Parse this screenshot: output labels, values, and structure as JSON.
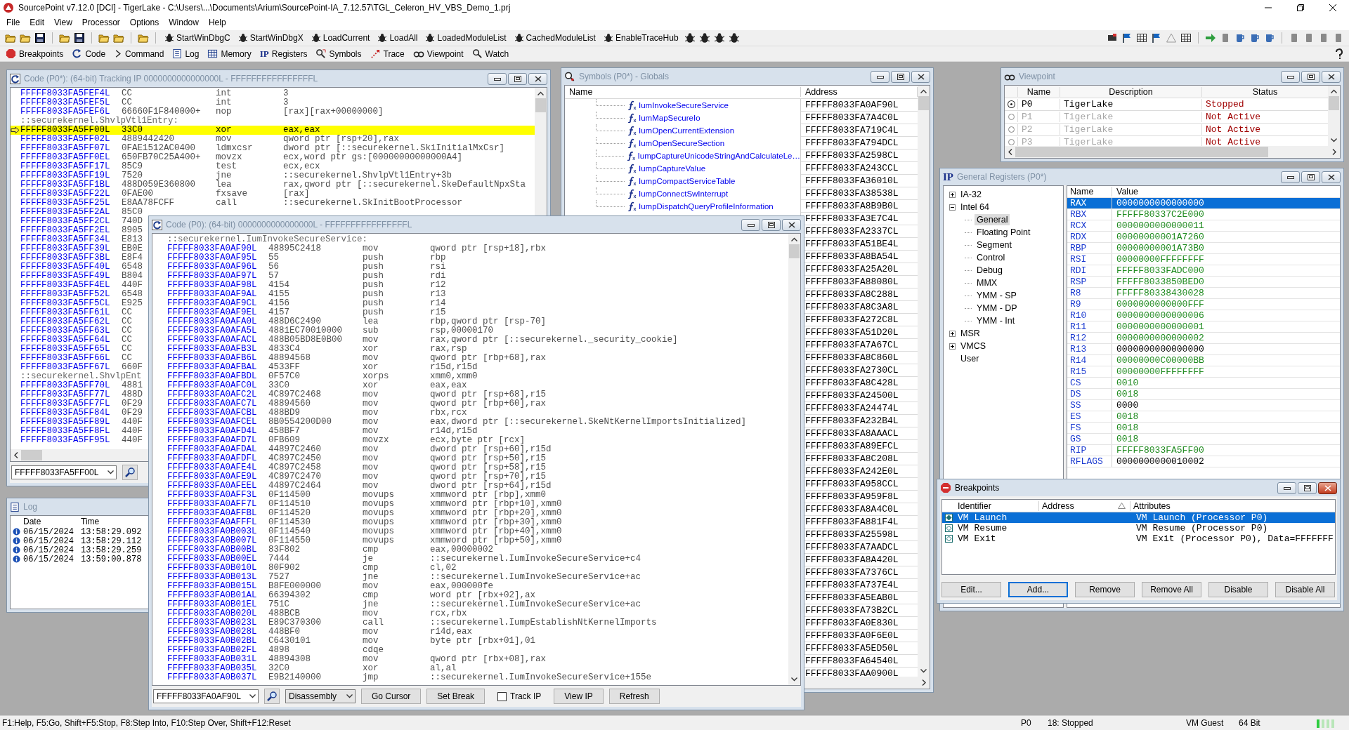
{
  "app": {
    "title": "SourcePoint v7.12.0 [DCI] - TigerLake - C:\\Users\\...\\Documents\\Arium\\SourcePoint-IA_7.12.57\\TGL_Celeron_HV_VBS_Demo_1.prj",
    "menu": [
      "File",
      "Edit",
      "View",
      "Processor",
      "Options",
      "Window",
      "Help"
    ]
  },
  "toolbar": {
    "commands": [
      "StartWinDbgC",
      "StartWinDbgX",
      "LoadCurrent",
      "LoadAll",
      "LoadedModuleList",
      "CachedModuleList",
      "EnableTraceHub"
    ]
  },
  "view_bar": [
    {
      "kind": "stop",
      "label": "Breakpoints"
    },
    {
      "kind": "code",
      "label": "Code"
    },
    {
      "kind": "command",
      "label": "Command"
    },
    {
      "kind": "log",
      "label": "Log"
    },
    {
      "kind": "memory",
      "label": "Memory"
    },
    {
      "kind": "registers",
      "glyph": "IP",
      "label": "Registers"
    },
    {
      "kind": "symbols",
      "label": "Symbols"
    },
    {
      "kind": "trace",
      "label": "Trace"
    },
    {
      "kind": "viewpoint",
      "label": "Viewpoint"
    },
    {
      "kind": "watch",
      "label": "Watch"
    }
  ],
  "code_tracking": {
    "title": "Code (P0*): (64-bit) Tracking IP 0000000000000000L - FFFFFFFFFFFFFFFFL",
    "active": false,
    "address_field": "FFFFF8033FA5FF00L",
    "rows": [
      {
        "kind": "instr",
        "current": false,
        "address": "FFFFF8033FA5FEF4L",
        "opcode": "CC",
        "mnemonic": "int",
        "operand": "3"
      },
      {
        "kind": "instr",
        "current": false,
        "address": "FFFFF8033FA5FEF5L",
        "opcode": "CC",
        "mnemonic": "int",
        "operand": "3"
      },
      {
        "kind": "instr",
        "current": false,
        "address": "FFFFF8033FA5FEF6L",
        "opcode": "66660F1F840000+",
        "mnemonic": "nop",
        "operand": "[rax][rax+00000000]"
      },
      {
        "kind": "label",
        "text": "::securekernel.ShvlpVtl1Entry:"
      },
      {
        "kind": "instr",
        "current": true,
        "address": "FFFFF8033FA5FF00L",
        "opcode": "33C0",
        "mnemonic": "xor",
        "operand": "eax,eax"
      },
      {
        "kind": "instr",
        "current": false,
        "address": "FFFFF8033FA5FF02L",
        "opcode": "4889442420",
        "mnemonic": "mov",
        "operand": "qword ptr [rsp+20],rax"
      },
      {
        "kind": "instr",
        "current": false,
        "address": "FFFFF8033FA5FF07L",
        "opcode": "0FAE1512AC0400",
        "mnemonic": "ldmxcsr",
        "operand": "dword ptr [::securekernel.SkiInitialMxCsr]"
      },
      {
        "kind": "instr",
        "current": false,
        "address": "FFFFF8033FA5FF0EL",
        "opcode": "650FB70C25A400+",
        "mnemonic": "movzx",
        "operand": "ecx,word ptr gs:[00000000000000A4]"
      },
      {
        "kind": "instr",
        "current": false,
        "address": "FFFFF8033FA5FF17L",
        "opcode": "85C9",
        "mnemonic": "test",
        "operand": "ecx,ecx"
      },
      {
        "kind": "instr",
        "current": false,
        "address": "FFFFF8033FA5FF19L",
        "opcode": "7520",
        "mnemonic": "jne",
        "operand": "::securekernel.ShvlpVtl1Entry+3b"
      },
      {
        "kind": "instr",
        "current": false,
        "address": "FFFFF8033FA5FF1BL",
        "opcode": "488D059E360800",
        "mnemonic": "lea",
        "operand": "rax,qword ptr [::securekernel.SkeDefaultNpxSta"
      },
      {
        "kind": "instr",
        "current": false,
        "address": "FFFFF8033FA5FF22L",
        "opcode": "0FAE00",
        "mnemonic": "fxsave",
        "operand": "[rax]"
      },
      {
        "kind": "instr",
        "current": false,
        "address": "FFFFF8033FA5FF25L",
        "opcode": "E8AA78FCFF",
        "mnemonic": "call",
        "operand": "::securekernel.SkInitBootProcessor"
      },
      {
        "kind": "instr",
        "current": false,
        "address": "FFFFF8033FA5FF2AL",
        "opcode": "85C0"
      },
      {
        "kind": "instr",
        "current": false,
        "address": "FFFFF8033FA5FF2CL",
        "opcode": "740D"
      },
      {
        "kind": "instr",
        "current": false,
        "address": "FFFFF8033FA5FF2EL",
        "opcode": "8905"
      },
      {
        "kind": "instr",
        "current": false,
        "address": "FFFFF8033FA5FF34L",
        "opcode": "E813"
      },
      {
        "kind": "instr",
        "current": false,
        "address": "FFFFF8033FA5FF39L",
        "opcode": "EB0E"
      },
      {
        "kind": "instr",
        "current": false,
        "address": "FFFFF8033FA5FF3BL",
        "opcode": "E8F4"
      },
      {
        "kind": "instr",
        "current": false,
        "address": "FFFFF8033FA5FF40L",
        "opcode": "6548"
      },
      {
        "kind": "instr",
        "current": false,
        "address": "FFFFF8033FA5FF49L",
        "opcode": "B804"
      },
      {
        "kind": "instr",
        "current": false,
        "address": "FFFFF8033FA5FF4EL",
        "opcode": "440F"
      },
      {
        "kind": "instr",
        "current": false,
        "address": "FFFFF8033FA5FF52L",
        "opcode": "6548"
      },
      {
        "kind": "instr",
        "current": false,
        "address": "FFFFF8033FA5FF5CL",
        "opcode": "E925"
      },
      {
        "kind": "instr",
        "current": false,
        "address": "FFFFF8033FA5FF61L",
        "opcode": "CC"
      },
      {
        "kind": "instr",
        "current": false,
        "address": "FFFFF8033FA5FF62L",
        "opcode": "CC"
      },
      {
        "kind": "instr",
        "current": false,
        "address": "FFFFF8033FA5FF63L",
        "opcode": "CC"
      },
      {
        "kind": "instr",
        "current": false,
        "address": "FFFFF8033FA5FF64L",
        "opcode": "CC"
      },
      {
        "kind": "instr",
        "current": false,
        "address": "FFFFF8033FA5FF65L",
        "opcode": "CC"
      },
      {
        "kind": "instr",
        "current": false,
        "address": "FFFFF8033FA5FF66L",
        "opcode": "CC"
      },
      {
        "kind": "instr",
        "current": false,
        "address": "FFFFF8033FA5FF67L",
        "opcode": "660F"
      },
      {
        "kind": "label",
        "text": "::securekernel.ShvlpEnt"
      },
      {
        "kind": "instr",
        "current": false,
        "address": "FFFFF8033FA5FF70L",
        "opcode": "4881"
      },
      {
        "kind": "instr",
        "current": false,
        "address": "FFFFF8033FA5FF77L",
        "opcode": "488D"
      },
      {
        "kind": "instr",
        "current": false,
        "address": "FFFFF8033FA5FF7FL",
        "opcode": "0F29"
      },
      {
        "kind": "instr",
        "current": false,
        "address": "FFFFF8033FA5FF84L",
        "opcode": "0F29"
      },
      {
        "kind": "instr",
        "current": false,
        "address": "FFFFF8033FA5FF89L",
        "opcode": "440F"
      },
      {
        "kind": "instr",
        "current": false,
        "address": "FFFFF8033FA5FF8FL",
        "opcode": "440F"
      },
      {
        "kind": "instr",
        "current": false,
        "address": "FFFFF8033FA5FF95L",
        "opcode": "440F"
      }
    ]
  },
  "log": {
    "title": "Log",
    "active": false,
    "columns": [
      "Date",
      "Time"
    ],
    "rows": [
      {
        "date": "06/15/2024",
        "time": "13:58:29.092"
      },
      {
        "date": "06/15/2024",
        "time": "13:58:29.112"
      },
      {
        "date": "06/15/2024",
        "time": "13:58:29.259"
      },
      {
        "date": "06/15/2024",
        "time": "13:59:00.878"
      }
    ]
  },
  "symbols": {
    "title": "Symbols (P0*) - Globals",
    "active": false,
    "columns": [
      "Name",
      "Address"
    ],
    "rows": [
      {
        "name": "IumInvokeSecureService",
        "address": "FFFFF8033FA0AF90L"
      },
      {
        "name": "IumMapSecureIo",
        "address": "FFFFF8033FA7A4C0L"
      },
      {
        "name": "IumOpenCurrentExtension",
        "address": "FFFFF8033FA719C4L"
      },
      {
        "name": "IumOpenSecureSection",
        "address": "FFFFF8033FA794DCL"
      },
      {
        "name": "IumpCaptureUnicodeStringAndCalculateLe…",
        "address": "FFFFF8033FA2598CL"
      },
      {
        "name": "IumpCaptureValue",
        "address": "FFFFF8033FA243CCL"
      },
      {
        "name": "IumpCompactServiceTable",
        "address": "FFFFF8033FA36010L"
      },
      {
        "name": "IumpConnectSwInterrupt",
        "address": "FFFFF8033FA38538L"
      },
      {
        "name": "IumpDispatchQueryProfileInformation",
        "address": "FFFFF8033FA8B9B0L"
      },
      {
        "address": "FFFFF8033FA3E7C4L"
      },
      {
        "address": "FFFFF8033FA2337CL"
      },
      {
        "address": "FFFFF8033FA51BE4L"
      },
      {
        "address": "FFFFF8033FA8BA54L"
      },
      {
        "address": "FFFFF8033FA25A20L"
      },
      {
        "address": "FFFFF8033FA88080L"
      },
      {
        "address": "FFFFF8033FA8C288L"
      },
      {
        "address": "FFFFF8033FA8C3A8L"
      },
      {
        "address": "FFFFF8033FA272C8L"
      },
      {
        "address": "FFFFF8033FA51D20L"
      },
      {
        "address": "FFFFF8033FA7A67CL"
      },
      {
        "address": "FFFFF8033FA8C860L"
      },
      {
        "address": "FFFFF8033FA2730CL"
      },
      {
        "address": "FFFFF8033FA8C428L"
      },
      {
        "address": "FFFFF8033FA24500L"
      },
      {
        "address": "FFFFF8033FA24474L"
      },
      {
        "address": "FFFFF8033FA232B4L"
      },
      {
        "address": "FFFFF8033FA8AAACL"
      },
      {
        "address": "FFFFF8033FA89EFCL"
      },
      {
        "address": "FFFFF8033FA8C208L"
      },
      {
        "address": "FFFFF8033FA242E0L"
      },
      {
        "address": "FFFFF8033FA958CCL"
      },
      {
        "address": "FFFFF8033FA959F8L"
      },
      {
        "address": "FFFFF8033FA8A4C0L"
      },
      {
        "address": "FFFFF8033FA881F4L"
      },
      {
        "address": "FFFFF8033FA25598L"
      },
      {
        "address": "FFFFF8033FA7AADCL"
      },
      {
        "address": "FFFFF8033FA8A420L"
      },
      {
        "address": "FFFFF8033FA7376CL"
      },
      {
        "address": "FFFFF8033FA737E4L"
      },
      {
        "address": "FFFFF8033FA5EAB0L"
      },
      {
        "address": "FFFFF8033FA73B2CL"
      },
      {
        "address": "FFFFF8033FA0E830L"
      },
      {
        "address": "FFFFF8033FA0F6E0L"
      },
      {
        "address": "FFFFF8033FA5ED50L"
      },
      {
        "address": "FFFFF8033FA64540L"
      },
      {
        "address": "FFFFF8033FAA0900L"
      }
    ]
  },
  "viewpoint": {
    "title": "Viewpoint",
    "active": false,
    "columns": [
      "Name",
      "Description",
      "Status"
    ],
    "rows": [
      {
        "selected": true,
        "active": true,
        "name": "P0",
        "description": "TigerLake",
        "status": "Stopped"
      },
      {
        "selected": false,
        "active": false,
        "name": "P1",
        "description": "TigerLake",
        "status": "Not Active"
      },
      {
        "selected": false,
        "active": false,
        "name": "P2",
        "description": "TigerLake",
        "status": "Not Active"
      },
      {
        "selected": false,
        "active": false,
        "name": "P3",
        "description": "TigerLake",
        "status": "Not Active"
      }
    ]
  },
  "registers": {
    "glyph": "IP",
    "title": "General Registers (P0*)",
    "active": false,
    "tree": [
      {
        "label": "IA-32",
        "expanded": false,
        "selected": false
      },
      {
        "label": "Intel 64",
        "expanded": true,
        "selected": false,
        "children": [
          {
            "label": "General",
            "selected": true
          },
          {
            "label": "Floating Point",
            "selected": false
          },
          {
            "label": "Segment",
            "selected": false
          },
          {
            "label": "Control",
            "selected": false
          },
          {
            "label": "Debug",
            "selected": false
          },
          {
            "label": "MMX",
            "selected": false
          },
          {
            "label": "YMM - SP",
            "selected": false
          },
          {
            "label": "YMM - DP",
            "selected": false
          },
          {
            "label": "YMM - Int",
            "selected": false
          }
        ]
      },
      {
        "label": "MSR",
        "expanded": false,
        "selected": false
      },
      {
        "label": "VMCS",
        "expanded": false,
        "selected": false
      },
      {
        "label": "User",
        "selected": false
      }
    ],
    "columns": [
      "Name",
      "Value"
    ],
    "rows": [
      {
        "name": "RAX",
        "value": "0000000000000000",
        "selected": true,
        "changed": false
      },
      {
        "name": "RBX",
        "value": "FFFFF80337C2E000",
        "selected": false,
        "changed": true
      },
      {
        "name": "RCX",
        "value": "0000000000000011",
        "selected": false,
        "changed": true
      },
      {
        "name": "RDX",
        "value": "00000000001A7260",
        "selected": false,
        "changed": true
      },
      {
        "name": "RBP",
        "value": "00000000001A73B0",
        "selected": false,
        "changed": true
      },
      {
        "name": "RSI",
        "value": "00000000FFFFFFFF",
        "selected": false,
        "changed": true
      },
      {
        "name": "RDI",
        "value": "FFFFF8033FADC000",
        "selected": false,
        "changed": true
      },
      {
        "name": "RSP",
        "value": "FFFFF8033850BED0",
        "selected": false,
        "changed": true
      },
      {
        "name": "R8",
        "value": "FFFFF80338430028",
        "selected": false,
        "changed": true
      },
      {
        "name": "R9",
        "value": "0000000000000FFF",
        "selected": false,
        "changed": true
      },
      {
        "name": "R10",
        "value": "0000000000000006",
        "selected": false,
        "changed": true
      },
      {
        "name": "R11",
        "value": "0000000000000001",
        "selected": false,
        "changed": true
      },
      {
        "name": "R12",
        "value": "0000000000000002",
        "selected": false,
        "changed": true
      },
      {
        "name": "R13",
        "value": "0000000000000000",
        "selected": false,
        "changed": false
      },
      {
        "name": "R14",
        "value": "00000000C00000BB",
        "selected": false,
        "changed": true
      },
      {
        "name": "R15",
        "value": "00000000FFFFFFFF",
        "selected": false,
        "changed": true
      },
      {
        "name": "CS",
        "value": "0010",
        "selected": false,
        "changed": true
      },
      {
        "name": "DS",
        "value": "0018",
        "selected": false,
        "changed": true
      },
      {
        "name": "SS",
        "value": "0000",
        "selected": false,
        "changed": false
      },
      {
        "name": "ES",
        "value": "0018",
        "selected": false,
        "changed": true
      },
      {
        "name": "FS",
        "value": "0018",
        "selected": false,
        "changed": true
      },
      {
        "name": "GS",
        "value": "0018",
        "selected": false,
        "changed": true
      },
      {
        "name": "RIP",
        "value": "FFFFF8033FA5FF00",
        "selected": false,
        "changed": true
      },
      {
        "name": "RFLAGS",
        "value": "0000000000010002",
        "selected": false,
        "changed": false
      }
    ]
  },
  "code": {
    "title": "Code (P0): (64-bit) 0000000000000000L - FFFFFFFFFFFFFFFFL",
    "active": false,
    "address_field": "FFFFF8033FA0AF90L",
    "view_select": "Disassembly",
    "buttons": [
      "Go Cursor",
      "Set Break"
    ],
    "track_ip": {
      "label": "Track IP",
      "checked": false
    },
    "buttons_after": [
      "View IP",
      "Refresh"
    ],
    "rows": [
      {
        "kind": "label",
        "text": "::securekernel.IumInvokeSecureService:"
      },
      {
        "kind": "instr",
        "address": "FFFFF8033FA0AF90L",
        "opcode": "48895C2418",
        "mnemonic": "mov",
        "operand": "qword ptr [rsp+18],rbx"
      },
      {
        "kind": "instr",
        "address": "FFFFF8033FA0AF95L",
        "opcode": "55",
        "mnemonic": "push",
        "operand": "rbp"
      },
      {
        "kind": "instr",
        "address": "FFFFF8033FA0AF96L",
        "opcode": "56",
        "mnemonic": "push",
        "operand": "rsi"
      },
      {
        "kind": "instr",
        "address": "FFFFF8033FA0AF97L",
        "opcode": "57",
        "mnemonic": "push",
        "operand": "rdi"
      },
      {
        "kind": "instr",
        "address": "FFFFF8033FA0AF98L",
        "opcode": "4154",
        "mnemonic": "push",
        "operand": "r12"
      },
      {
        "kind": "instr",
        "address": "FFFFF8033FA0AF9AL",
        "opcode": "4155",
        "mnemonic": "push",
        "operand": "r13"
      },
      {
        "kind": "instr",
        "address": "FFFFF8033FA0AF9CL",
        "opcode": "4156",
        "mnemonic": "push",
        "operand": "r14"
      },
      {
        "kind": "instr",
        "address": "FFFFF8033FA0AF9EL",
        "opcode": "4157",
        "mnemonic": "push",
        "operand": "r15"
      },
      {
        "kind": "instr",
        "address": "FFFFF8033FA0AFA0L",
        "opcode": "488D6C2490",
        "mnemonic": "lea",
        "operand": "rbp,qword ptr [rsp-70]"
      },
      {
        "kind": "instr",
        "address": "FFFFF8033FA0AFA5L",
        "opcode": "4881EC70010000",
        "mnemonic": "sub",
        "operand": "rsp,00000170"
      },
      {
        "kind": "instr",
        "address": "FFFFF8033FA0AFACL",
        "opcode": "488B05BD8E0B00",
        "mnemonic": "mov",
        "operand": "rax,qword ptr [::securekernel._security_cookie]"
      },
      {
        "kind": "instr",
        "address": "FFFFF8033FA0AFB3L",
        "opcode": "4833C4",
        "mnemonic": "xor",
        "operand": "rax,rsp"
      },
      {
        "kind": "instr",
        "address": "FFFFF8033FA0AFB6L",
        "opcode": "48894568",
        "mnemonic": "mov",
        "operand": "qword ptr [rbp+68],rax"
      },
      {
        "kind": "instr",
        "address": "FFFFF8033FA0AFBAL",
        "opcode": "4533FF",
        "mnemonic": "xor",
        "operand": "r15d,r15d"
      },
      {
        "kind": "instr",
        "address": "FFFFF8033FA0AFBDL",
        "opcode": "0F57C0",
        "mnemonic": "xorps",
        "operand": "xmm0,xmm0"
      },
      {
        "kind": "instr",
        "address": "FFFFF8033FA0AFC0L",
        "opcode": "33C0",
        "mnemonic": "xor",
        "operand": "eax,eax"
      },
      {
        "kind": "instr",
        "address": "FFFFF8033FA0AFC2L",
        "opcode": "4C897C2468",
        "mnemonic": "mov",
        "operand": "qword ptr [rsp+68],r15"
      },
      {
        "kind": "instr",
        "address": "FFFFF8033FA0AFC7L",
        "opcode": "48894560",
        "mnemonic": "mov",
        "operand": "qword ptr [rbp+60],rax"
      },
      {
        "kind": "instr",
        "address": "FFFFF8033FA0AFCBL",
        "opcode": "488BD9",
        "mnemonic": "mov",
        "operand": "rbx,rcx"
      },
      {
        "kind": "instr",
        "address": "FFFFF8033FA0AFCEL",
        "opcode": "8B0554200D00",
        "mnemonic": "mov",
        "operand": "eax,dword ptr [::securekernel.SkeNtKernelImportsInitialized]"
      },
      {
        "kind": "instr",
        "address": "FFFFF8033FA0AFD4L",
        "opcode": "458BF7",
        "mnemonic": "mov",
        "operand": "r14d,r15d"
      },
      {
        "kind": "instr",
        "address": "FFFFF8033FA0AFD7L",
        "opcode": "0FB609",
        "mnemonic": "movzx",
        "operand": "ecx,byte ptr [rcx]"
      },
      {
        "kind": "instr",
        "address": "FFFFF8033FA0AFDAL",
        "opcode": "44897C2460",
        "mnemonic": "mov",
        "operand": "dword ptr [rsp+60],r15d"
      },
      {
        "kind": "instr",
        "address": "FFFFF8033FA0AFDFL",
        "opcode": "4C897C2450",
        "mnemonic": "mov",
        "operand": "qword ptr [rsp+50],r15"
      },
      {
        "kind": "instr",
        "address": "FFFFF8033FA0AFE4L",
        "opcode": "4C897C2458",
        "mnemonic": "mov",
        "operand": "qword ptr [rsp+58],r15"
      },
      {
        "kind": "instr",
        "address": "FFFFF8033FA0AFE9L",
        "opcode": "4C897C2470",
        "mnemonic": "mov",
        "operand": "qword ptr [rsp+70],r15"
      },
      {
        "kind": "instr",
        "address": "FFFFF8033FA0AFEEL",
        "opcode": "44897C2464",
        "mnemonic": "mov",
        "operand": "dword ptr [rsp+64],r15d"
      },
      {
        "kind": "instr",
        "address": "FFFFF8033FA0AFF3L",
        "opcode": "0F114500",
        "mnemonic": "movups",
        "operand": "xmmword ptr [rbp],xmm0"
      },
      {
        "kind": "instr",
        "address": "FFFFF8033FA0AFF7L",
        "opcode": "0F114510",
        "mnemonic": "movups",
        "operand": "xmmword ptr [rbp+10],xmm0"
      },
      {
        "kind": "instr",
        "address": "FFFFF8033FA0AFFBL",
        "opcode": "0F114520",
        "mnemonic": "movups",
        "operand": "xmmword ptr [rbp+20],xmm0"
      },
      {
        "kind": "instr",
        "address": "FFFFF8033FA0AFFFL",
        "opcode": "0F114530",
        "mnemonic": "movups",
        "operand": "xmmword ptr [rbp+30],xmm0"
      },
      {
        "kind": "instr",
        "address": "FFFFF8033FA0B003L",
        "opcode": "0F114540",
        "mnemonic": "movups",
        "operand": "xmmword ptr [rbp+40],xmm0"
      },
      {
        "kind": "instr",
        "address": "FFFFF8033FA0B007L",
        "opcode": "0F114550",
        "mnemonic": "movups",
        "operand": "xmmword ptr [rbp+50],xmm0"
      },
      {
        "kind": "instr",
        "address": "FFFFF8033FA0B00BL",
        "opcode": "83F802",
        "mnemonic": "cmp",
        "operand": "eax,00000002"
      },
      {
        "kind": "instr",
        "address": "FFFFF8033FA0B00EL",
        "opcode": "7444",
        "mnemonic": "je",
        "operand": "::securekernel.IumInvokeSecureService+c4"
      },
      {
        "kind": "instr",
        "address": "FFFFF8033FA0B010L",
        "opcode": "80F902",
        "mnemonic": "cmp",
        "operand": "cl,02"
      },
      {
        "kind": "instr",
        "address": "FFFFF8033FA0B013L",
        "opcode": "7527",
        "mnemonic": "jne",
        "operand": "::securekernel.IumInvokeSecureService+ac"
      },
      {
        "kind": "instr",
        "address": "FFFFF8033FA0B015L",
        "opcode": "B8FE000000",
        "mnemonic": "mov",
        "operand": "eax,000000fe"
      },
      {
        "kind": "instr",
        "address": "FFFFF8033FA0B01AL",
        "opcode": "66394302",
        "mnemonic": "cmp",
        "operand": "word ptr [rbx+02],ax"
      },
      {
        "kind": "instr",
        "address": "FFFFF8033FA0B01EL",
        "opcode": "751C",
        "mnemonic": "jne",
        "operand": "::securekernel.IumInvokeSecureService+ac"
      },
      {
        "kind": "instr",
        "address": "FFFFF8033FA0B020L",
        "opcode": "488BCB",
        "mnemonic": "mov",
        "operand": "rcx,rbx"
      },
      {
        "kind": "instr",
        "address": "FFFFF8033FA0B023L",
        "opcode": "E89C370300",
        "mnemonic": "call",
        "operand": "::securekernel.IumpEstablishNtKernelImports"
      },
      {
        "kind": "instr",
        "address": "FFFFF8033FA0B028L",
        "opcode": "448BF0",
        "mnemonic": "mov",
        "operand": "r14d,eax"
      },
      {
        "kind": "instr",
        "address": "FFFFF8033FA0B02BL",
        "opcode": "C6430101",
        "mnemonic": "mov",
        "operand": "byte ptr [rbx+01],01"
      },
      {
        "kind": "instr",
        "address": "FFFFF8033FA0B02FL",
        "opcode": "4898",
        "mnemonic": "cdqe"
      },
      {
        "kind": "instr",
        "address": "FFFFF8033FA0B031L",
        "opcode": "48894308",
        "mnemonic": "mov",
        "operand": "qword ptr [rbx+08],rax"
      },
      {
        "kind": "instr",
        "address": "FFFFF8033FA0B035L",
        "opcode": "32C0",
        "mnemonic": "xor",
        "operand": "al,al"
      },
      {
        "kind": "instr",
        "address": "FFFFF8033FA0B037L",
        "opcode": "E9B2140000",
        "mnemonic": "jmp",
        "operand": "::securekernel.IumInvokeSecureService+155e"
      }
    ]
  },
  "breakpoints": {
    "title": "Breakpoints",
    "active": true,
    "columns": [
      "Identifier",
      "Address",
      "Attributes"
    ],
    "rows": [
      {
        "selected": true,
        "identifier": "VM Launch",
        "attributes": "VM Launch (Processor P0)"
      },
      {
        "selected": false,
        "identifier": "VM Resume",
        "attributes": "VM Resume (Processor P0)"
      },
      {
        "selected": false,
        "identifier": "VM Exit",
        "attributes": "VM Exit (Processor P0), Data=FFFFFFF"
      }
    ],
    "buttons": [
      {
        "label": "Edit...",
        "default": false
      },
      {
        "label": "Add...",
        "default": true
      },
      {
        "label": "Remove",
        "default": false
      },
      {
        "label": "Remove All",
        "default": false
      },
      {
        "label": "Disable",
        "default": false
      },
      {
        "label": "Disable All",
        "default": false
      }
    ]
  },
  "status_bar": {
    "help": "F1:Help, F5:Go, Shift+F5:Stop, F8:Step Into, F10:Step Over, Shift+F12:Reset",
    "processor": "P0",
    "state": "18: Stopped",
    "mode": "VM Guest",
    "bits": "64 Bit"
  }
}
